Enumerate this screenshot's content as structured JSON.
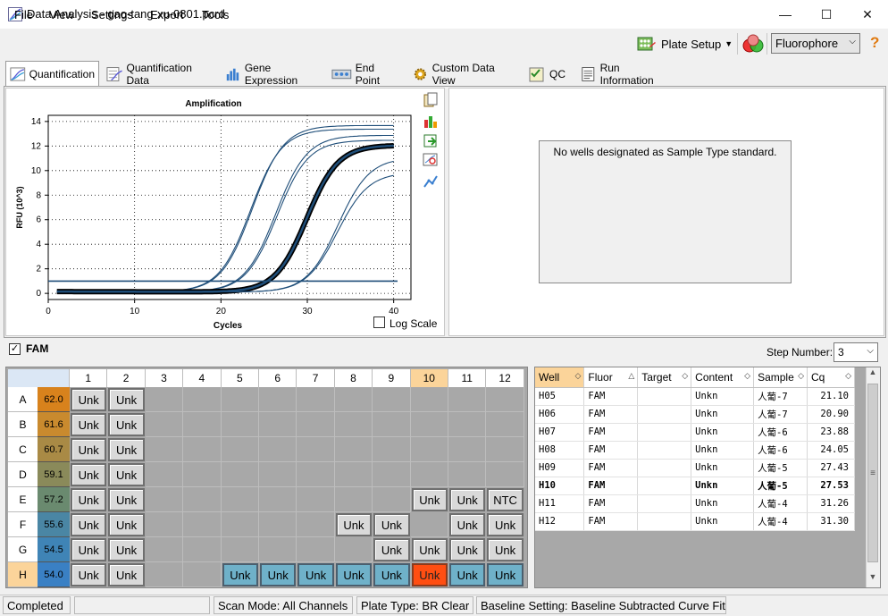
{
  "window": {
    "title": "Data Analysis - gao-tang-xu-0801.pcrd",
    "minimize": "—",
    "maximize": "☐",
    "close": "✕"
  },
  "menu": [
    "File",
    "View",
    "Settings",
    "Export",
    "Tools"
  ],
  "toolbar": {
    "plate_setup": "Plate Setup",
    "fluorophore": "Fluorophore",
    "help": "?"
  },
  "tabs": [
    "Quantification",
    "Quantification Data",
    "Gene Expression",
    "End Point",
    "Custom Data View",
    "QC",
    "Run Information"
  ],
  "chart": {
    "title": "Amplification",
    "xlabel": "Cycles",
    "ylabel": "RFU (10^3)",
    "log_scale": "Log Scale"
  },
  "chart_data": {
    "type": "line",
    "title": "Amplification",
    "xlabel": "Cycles",
    "ylabel": "RFU (10^3)",
    "xlim": [
      0,
      42
    ],
    "ylim": [
      -0.5,
      14.5
    ],
    "xticks": [
      0,
      10,
      20,
      30,
      40
    ],
    "yticks": [
      0,
      2,
      4,
      6,
      8,
      10,
      12,
      14
    ],
    "threshold": 1.0,
    "grid": true,
    "series": [
      {
        "cq": 21.1,
        "plateau": 13.6,
        "bold": false
      },
      {
        "cq": 20.9,
        "plateau": 13.3,
        "bold": false
      },
      {
        "cq": 23.88,
        "plateau": 12.8,
        "bold": false
      },
      {
        "cq": 24.05,
        "plateau": 12.4,
        "bold": false
      },
      {
        "cq": 27.43,
        "plateau": 12.0,
        "bold": false
      },
      {
        "cq": 27.53,
        "plateau": 12.0,
        "bold": true
      },
      {
        "cq": 31.26,
        "plateau": 11.0,
        "bold": false
      },
      {
        "cq": 31.3,
        "plateau": 9.8,
        "bold": false
      }
    ]
  },
  "standard_panel": {
    "message": "No wells designated as Sample Type standard."
  },
  "fam_bar": {
    "check": "✓",
    "label": "FAM",
    "step_label": "Step Number:",
    "step_value": "3"
  },
  "plate": {
    "columns": [
      "1",
      "2",
      "3",
      "4",
      "5",
      "6",
      "7",
      "8",
      "9",
      "10",
      "11",
      "12"
    ],
    "highlight_column": "10",
    "highlight_row": "H",
    "rows": [
      {
        "label": "A",
        "temp": "62.0",
        "temp_color": "#d8821c",
        "wells": [
          "Unk",
          "Unk",
          "",
          "",
          "",
          "",
          "",
          "",
          "",
          "",
          "",
          ""
        ]
      },
      {
        "label": "B",
        "temp": "61.6",
        "temp_color": "#c98a2e",
        "wells": [
          "Unk",
          "Unk",
          "",
          "",
          "",
          "",
          "",
          "",
          "",
          "",
          "",
          ""
        ]
      },
      {
        "label": "C",
        "temp": "60.7",
        "temp_color": "#a98a45",
        "wells": [
          "Unk",
          "Unk",
          "",
          "",
          "",
          "",
          "",
          "",
          "",
          "",
          "",
          ""
        ]
      },
      {
        "label": "D",
        "temp": "59.1",
        "temp_color": "#8a8a5a",
        "wells": [
          "Unk",
          "Unk",
          "",
          "",
          "",
          "",
          "",
          "",
          "",
          "",
          "",
          ""
        ]
      },
      {
        "label": "E",
        "temp": "57.2",
        "temp_color": "#6a8a6f",
        "wells": [
          "Unk",
          "Unk",
          "",
          "",
          "",
          "",
          "",
          "",
          "",
          "Unk",
          "Unk",
          "NTC"
        ]
      },
      {
        "label": "F",
        "temp": "55.6",
        "temp_color": "#4a86a4",
        "wells": [
          "Unk",
          "Unk",
          "",
          "",
          "",
          "",
          "",
          "Unk",
          "Unk",
          "",
          "Unk",
          "Unk"
        ]
      },
      {
        "label": "G",
        "temp": "54.5",
        "temp_color": "#3f84b6",
        "wells": [
          "Unk",
          "Unk",
          "",
          "",
          "",
          "",
          "",
          "",
          "Unk",
          "Unk",
          "Unk",
          "Unk"
        ]
      },
      {
        "label": "H",
        "temp": "54.0",
        "temp_color": "#3a80c4",
        "wells": [
          "Unk",
          "Unk",
          "",
          "",
          "Unk",
          "Unk",
          "Unk",
          "Unk",
          "Unk",
          "Unk",
          "Unk",
          "Unk"
        ]
      }
    ]
  },
  "table": {
    "headers": [
      "Well",
      "Fluor",
      "Target",
      "Content",
      "Sample",
      "Cq"
    ],
    "sort_icons": [
      "◇",
      "△",
      "◇",
      "◇",
      "◇",
      "◇"
    ],
    "rows": [
      [
        "H05",
        "FAM",
        "",
        "Unkn",
        "人葡-7",
        "21.10"
      ],
      [
        "H06",
        "FAM",
        "",
        "Unkn",
        "人葡-7",
        "20.90"
      ],
      [
        "H07",
        "FAM",
        "",
        "Unkn",
        "人葡-6",
        "23.88"
      ],
      [
        "H08",
        "FAM",
        "",
        "Unkn",
        "人葡-6",
        "24.05"
      ],
      [
        "H09",
        "FAM",
        "",
        "Unkn",
        "人葡-5",
        "27.43"
      ],
      [
        "H10",
        "FAM",
        "",
        "Unkn",
        "人葡-5",
        "27.53"
      ],
      [
        "H11",
        "FAM",
        "",
        "Unkn",
        "人葡-4",
        "31.26"
      ],
      [
        "H12",
        "FAM",
        "",
        "Unkn",
        "人葡-4",
        "31.30"
      ]
    ],
    "bold_row": 5
  },
  "status": {
    "state": "Completed",
    "scan_mode": "Scan Mode: All Channels",
    "plate_type": "Plate Type: BR Clear",
    "baseline": "Baseline Setting: Baseline Subtracted Curve Fit"
  }
}
